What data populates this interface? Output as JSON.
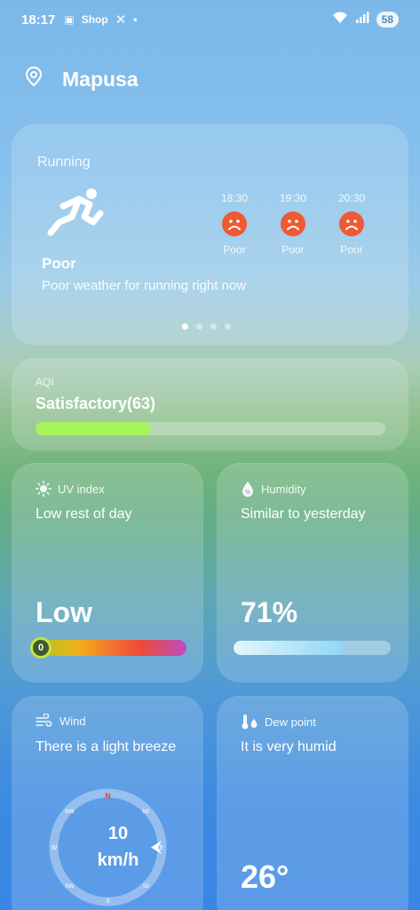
{
  "status_bar": {
    "time": "18:17",
    "notification_icons": [
      "screen-icon",
      "shop-icon",
      "x-icon"
    ],
    "shop_label": "Shop",
    "battery": "58"
  },
  "location": {
    "name": "Mapusa"
  },
  "running": {
    "label": "Running",
    "status": "Poor",
    "description": "Poor weather for running right now",
    "forecast": [
      {
        "time": "18:30",
        "quality": "Poor"
      },
      {
        "time": "19:30",
        "quality": "Poor"
      },
      {
        "time": "20:30",
        "quality": "Poor"
      }
    ],
    "page_count": 4,
    "active_page": 0
  },
  "aqi": {
    "label": "AQI",
    "value": "Satisfactory(63)",
    "level_fraction": 0.33
  },
  "uv": {
    "title": "UV index",
    "subtitle": "Low rest of day",
    "value": "Low",
    "index": "0"
  },
  "humidity": {
    "title": "Humidity",
    "subtitle": "Similar to yesterday",
    "value": "71%",
    "level_fraction": 0.71
  },
  "wind": {
    "title": "Wind",
    "subtitle": "There is a light breeze",
    "speed": "10",
    "unit": "km/h",
    "compass": [
      "N",
      "NE",
      "E",
      "SE",
      "S",
      "SW",
      "W",
      "NW"
    ]
  },
  "dew_point": {
    "title": "Dew point",
    "subtitle": "It is very humid",
    "value": "26°"
  },
  "colors": {
    "sad_face": "#ee5a32",
    "aqi_fill": "#a4f45a",
    "compass_north": "#ee4a3a"
  }
}
